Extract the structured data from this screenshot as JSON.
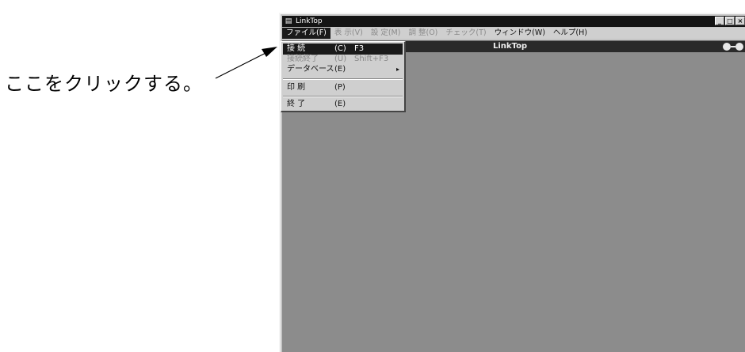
{
  "callout": {
    "text": "ここをクリックする。"
  },
  "window": {
    "title": "LinkTop",
    "icon": "app-icon",
    "controls": {
      "minimize": "_",
      "maximize": "□",
      "close": "×"
    }
  },
  "menubar": {
    "items": [
      {
        "label": "ファイル(F)",
        "state": "active"
      },
      {
        "label": "表 示(V)",
        "state": "disabled"
      },
      {
        "label": "設 定(M)",
        "state": "disabled"
      },
      {
        "label": "調 整(O)",
        "state": "disabled"
      },
      {
        "label": "チェック(T)",
        "state": "disabled"
      },
      {
        "label": "ウィンドウ(W)",
        "state": "enabled"
      },
      {
        "label": "ヘルプ(H)",
        "state": "enabled"
      }
    ]
  },
  "child_window": {
    "title": "LinkTop"
  },
  "file_menu": {
    "items": [
      {
        "label": "接 続",
        "key": "(C)",
        "shortcut": "F3",
        "state": "highlighted"
      },
      {
        "label": "接続終了",
        "key": "(U)",
        "shortcut": "Shift+F3",
        "state": "disabled"
      },
      {
        "label": "データベース",
        "key": "(E)",
        "shortcut": "",
        "state": "enabled",
        "submenu_arrow": "▸"
      },
      {
        "label": "印 刷",
        "key": "(P)",
        "shortcut": "",
        "state": "enabled"
      },
      {
        "label": "終 了",
        "key": "(E)",
        "shortcut": "",
        "state": "enabled"
      }
    ]
  }
}
